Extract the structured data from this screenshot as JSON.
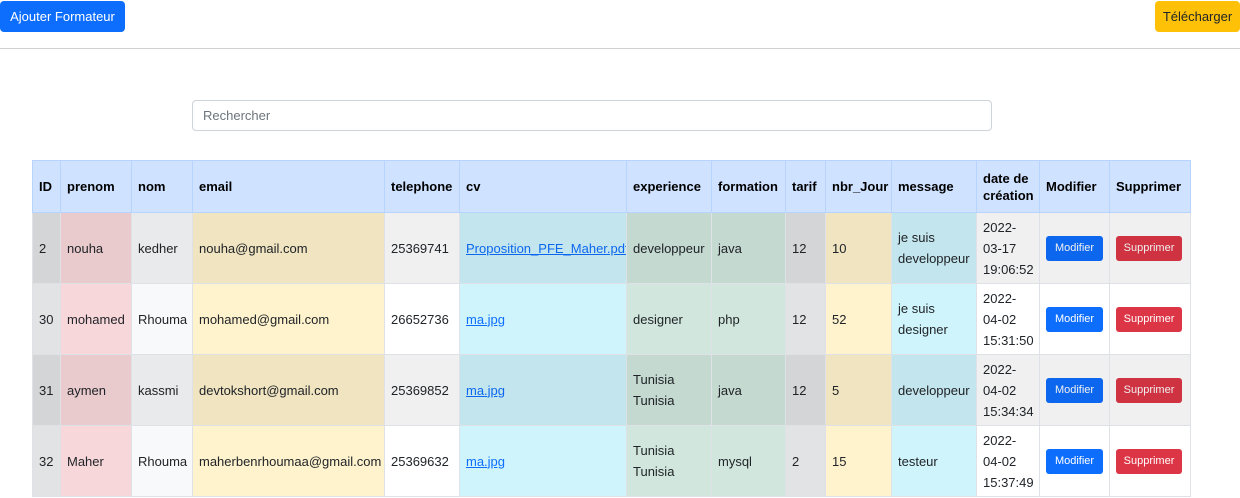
{
  "toolbar": {
    "add_label": "Ajouter Formateur",
    "download_label": "Télécharger"
  },
  "search": {
    "placeholder": "Rechercher"
  },
  "table": {
    "headers": [
      "ID",
      "prenom",
      "nom",
      "email",
      "telephone",
      "cv",
      "experience",
      "formation",
      "tarif",
      "nbr_Jour",
      "message",
      "date de création",
      "Modifier",
      "Supprimer"
    ],
    "rows": [
      {
        "id": "2",
        "prenom": "nouha",
        "nom": "kedher",
        "email": "nouha@gmail.com",
        "telephone": "25369741",
        "cv": "Proposition_PFE_Maher.pdf",
        "experience": "developpeur",
        "formation": "java",
        "tarif": "12",
        "nbr_jour": "10",
        "message": "je suis developpeur",
        "date": "2022-03-17 19:06:52",
        "modify_label": "Modifier",
        "delete_label": "Supprimer"
      },
      {
        "id": "30",
        "prenom": "mohamed",
        "nom": "Rhouma",
        "email": "mohamed@gmail.com",
        "telephone": "26652736",
        "cv": "ma.jpg",
        "experience": "designer",
        "formation": "php",
        "tarif": "12",
        "nbr_jour": "52",
        "message": "je suis designer",
        "date": "2022-04-02 15:31:50",
        "modify_label": "Modifier",
        "delete_label": "Supprimer"
      },
      {
        "id": "31",
        "prenom": "aymen",
        "nom": "kassmi",
        "email": "devtokshort@gmail.com",
        "telephone": "25369852",
        "cv": "ma.jpg",
        "experience": "Tunisia Tunisia",
        "formation": "java",
        "tarif": "12",
        "nbr_jour": "5",
        "message": "developpeur",
        "date": "2022-04-02 15:34:34",
        "modify_label": "Modifier",
        "delete_label": "Supprimer"
      },
      {
        "id": "32",
        "prenom": "Maher",
        "nom": "Rhouma",
        "email": "maherbenrhoumaa@gmail.com",
        "telephone": "25369632",
        "cv": "ma.jpg",
        "experience": "Tunisia Tunisia",
        "formation": "mysql",
        "tarif": "2",
        "nbr_jour": "15",
        "message": "testeur",
        "date": "2022-04-02 15:37:49",
        "modify_label": "Modifier",
        "delete_label": "Supprimer"
      }
    ]
  },
  "colors": {
    "primary": "#0d6efd",
    "warning": "#ffc107",
    "danger": "#dc3545",
    "header_bg": "#cfe2ff"
  }
}
